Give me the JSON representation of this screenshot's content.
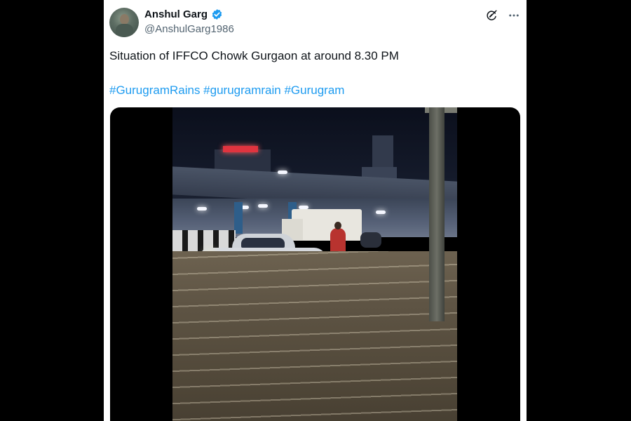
{
  "tweet": {
    "author_name": "Anshul Garg",
    "author_handle": "@AnshulGarg1986",
    "text": "Situation of IFFCO Chowk Gurgaon at around 8.30 PM",
    "hashtags": [
      "#GurugramRains",
      "#gurugramrain",
      "#Gurugram"
    ]
  },
  "icons": {
    "verified": "verified-badge-icon",
    "grok": "grok-icon",
    "more": "more-options-icon"
  },
  "colors": {
    "link": "#1d9bf0",
    "verified": "#1d9bf0",
    "text": "#0f1419",
    "secondary": "#536471"
  }
}
